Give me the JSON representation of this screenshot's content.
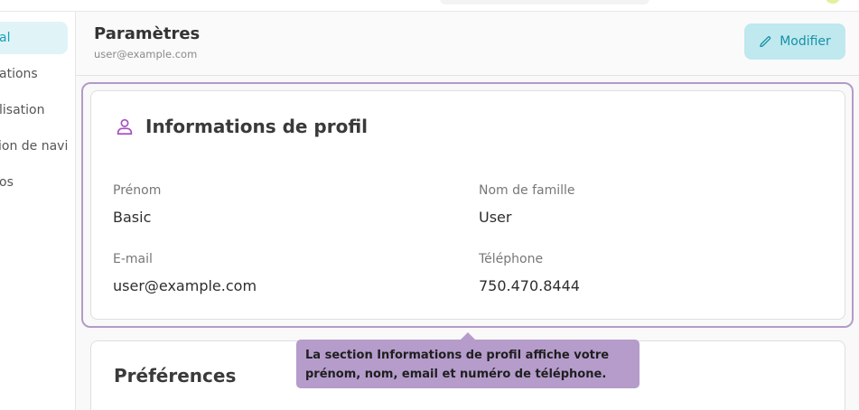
{
  "sidebar": {
    "items": [
      {
        "label": "al",
        "active": true
      },
      {
        "label": "ations"
      },
      {
        "label": "lisation"
      },
      {
        "label": "ion de navi"
      },
      {
        "label": "os"
      }
    ]
  },
  "header": {
    "title": "Paramètres",
    "subtitle": "user@example.com",
    "edit_label": "Modifier"
  },
  "profile": {
    "title": "Informations de profil",
    "fields": {
      "first_name": {
        "label": "Prénom",
        "value": "Basic"
      },
      "last_name": {
        "label": "Nom de famille",
        "value": "User"
      },
      "email": {
        "label": "E-mail",
        "value": "user@example.com"
      },
      "phone": {
        "label": "Téléphone",
        "value": "750.470.8444"
      }
    }
  },
  "preferences": {
    "title": "Préférences"
  },
  "tooltip": {
    "line1": "La section Informations de profil affiche votre",
    "line2": "prénom, nom, email et numéro de téléphone."
  },
  "colors": {
    "accent": "#17a2b8",
    "highlight": "#b39bc8",
    "tooltip_bg": "#b59ccb",
    "edit_button_bg": "#bfe8ef"
  },
  "icons": {
    "edit": "pencil-icon",
    "profile": "user-icon"
  }
}
